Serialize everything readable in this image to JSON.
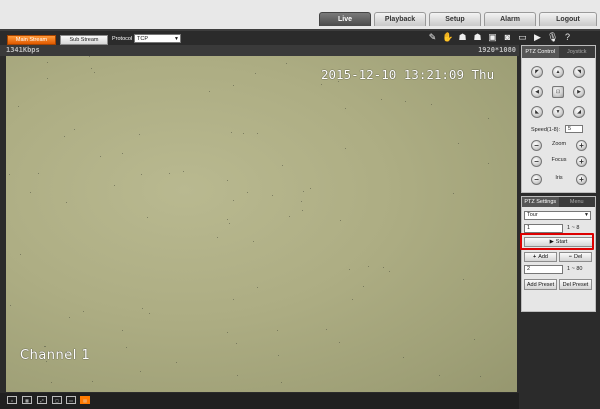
{
  "nav": {
    "tabs": [
      {
        "label": "Live",
        "active": true
      },
      {
        "label": "Playback"
      },
      {
        "label": "Setup"
      },
      {
        "label": "Alarm"
      },
      {
        "label": "Logout"
      }
    ]
  },
  "stream": {
    "main_label": "Main Stream",
    "sub_label": "Sub Stream",
    "protocol_label": "Protocol",
    "protocol_value": "TCP",
    "toolbar_icons": [
      "pen-icon",
      "hand-icon",
      "person-icon",
      "person-icon-2",
      "snapshot-icon",
      "record-icon",
      "window-icon",
      "video-icon",
      "mic-icon",
      "help-icon"
    ]
  },
  "video": {
    "bitrate": "1341Kbps",
    "resolution": "1920*1080",
    "timestamp": "2015-12-10 13:21:09 Thu",
    "channel": "Channel 1",
    "footer_icons": [
      "home-icon",
      "grid-icon",
      "fullscreen-icon",
      "fit-icon",
      "window-icon",
      "rect-icon"
    ]
  },
  "ptz": {
    "tab_control": "PTZ Control",
    "tab_joystick": "Joystick",
    "speed_label": "Speed(1-8):",
    "speed_value": "5",
    "zoom": "Zoom",
    "focus": "Focus",
    "iris": "Iris"
  },
  "ptz_settings": {
    "tab_settings": "PTZ Settings",
    "tab_menu": "Menu",
    "mode_value": "Tour",
    "tour_input": "1",
    "tour_range": "1 ~ 8",
    "start_label": "Start",
    "add_label": "Add",
    "del_label": "Del",
    "preset_input": "2",
    "preset_range": "1 ~ 80",
    "add_preset_label": "Add Preset",
    "del_preset_label": "Del Preset"
  },
  "colors": {
    "accent": "#ff7a00",
    "highlight": "#dd0000"
  }
}
